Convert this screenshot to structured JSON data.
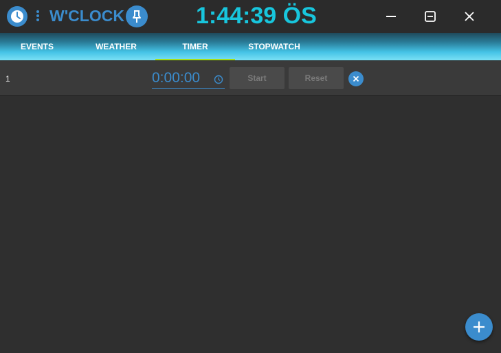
{
  "titlebar": {
    "app_name": "W'CLOCK",
    "clock_time": "1:44:39 ÖS",
    "icons": {
      "app": "clock-icon",
      "menu": "kebab-menu-icon",
      "pin": "pin-icon",
      "minimize": "minimize-icon",
      "maximize": "maximize-icon",
      "close": "close-icon"
    }
  },
  "tabs": [
    {
      "label": "EVENTS"
    },
    {
      "label": "WEATHER"
    },
    {
      "label": "TIMER",
      "active": true
    },
    {
      "label": "STOPWATCH"
    }
  ],
  "timers": [
    {
      "index": "1",
      "time_value": "0:00:00",
      "start_label": "Start",
      "reset_label": "Reset"
    }
  ],
  "colors": {
    "accent": "#3b8ccd",
    "clock": "#18c6dd",
    "active_tab_indicator": "#a6e01a",
    "background": "#2f2f2f"
  }
}
